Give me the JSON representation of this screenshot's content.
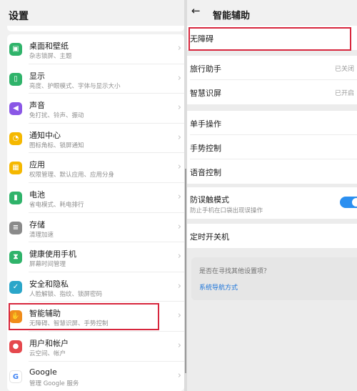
{
  "left": {
    "title": "设置",
    "items": [
      {
        "title": "桌面和壁纸",
        "subtitle": "杂志锁屏、主题",
        "icon": "wallpaper-icon",
        "color": "#2fb36a",
        "glyph": "▣"
      },
      {
        "title": "显示",
        "subtitle": "亮度、护眼模式、字体与显示大小",
        "icon": "display-icon",
        "color": "#2fb36a",
        "glyph": "▯"
      },
      {
        "title": "声音",
        "subtitle": "免打扰、铃声、振动",
        "icon": "sound-icon",
        "color": "#8a57e6",
        "glyph": "◀"
      },
      {
        "title": "通知中心",
        "subtitle": "图标角标、锁屏通知",
        "icon": "notification-icon",
        "color": "#f5b800",
        "glyph": "◔"
      },
      {
        "title": "应用",
        "subtitle": "权限管理、默认应用、应用分身",
        "icon": "apps-icon",
        "color": "#f5b800",
        "glyph": "▦"
      },
      {
        "title": "电池",
        "subtitle": "省电模式、耗电排行",
        "icon": "battery-icon",
        "color": "#2fb36a",
        "glyph": "▮"
      },
      {
        "title": "存储",
        "subtitle": "清理加速",
        "icon": "storage-icon",
        "color": "#8a8a8a",
        "glyph": "≡"
      },
      {
        "title": "健康使用手机",
        "subtitle": "屏幕时间管理",
        "icon": "hourglass-icon",
        "color": "#2fb36a",
        "glyph": "⧗"
      },
      {
        "title": "安全和隐私",
        "subtitle": "人脸解锁、指纹、锁屏密码",
        "icon": "shield-icon",
        "color": "#2aa6c9",
        "glyph": "✓"
      },
      {
        "title": "智能辅助",
        "subtitle": "无障碍、智慧识屏、手势控制",
        "icon": "hand-icon",
        "color": "#f08c1a",
        "glyph": "✋"
      },
      {
        "title": "用户和帐户",
        "subtitle": "云空间、帐户",
        "icon": "user-icon",
        "color": "#e5484d",
        "glyph": "●"
      },
      {
        "title": "Google",
        "subtitle": "管理 Google 服务",
        "icon": "google-icon",
        "color": "#ffffff",
        "glyph": "G"
      }
    ]
  },
  "right": {
    "title": "智能辅助",
    "items": [
      {
        "label": "无障碍"
      },
      {
        "label": "旅行助手",
        "value": "已关闭"
      },
      {
        "label": "智慧识屏",
        "value": "已开启"
      },
      {
        "label": "单手操作"
      },
      {
        "label": "手势控制"
      },
      {
        "label": "语音控制"
      },
      {
        "label": "防误触模式",
        "subtitle": "防止手机在口袋出现误操作",
        "toggle_on": true
      },
      {
        "label": "定时开关机"
      }
    ],
    "suggestion": {
      "question": "是否在寻找其他设置项？",
      "link": "系统导航方式"
    }
  },
  "colors": {
    "highlight": "#d7263d",
    "toggle": "#2b8ff0",
    "link": "#1a73d9"
  }
}
